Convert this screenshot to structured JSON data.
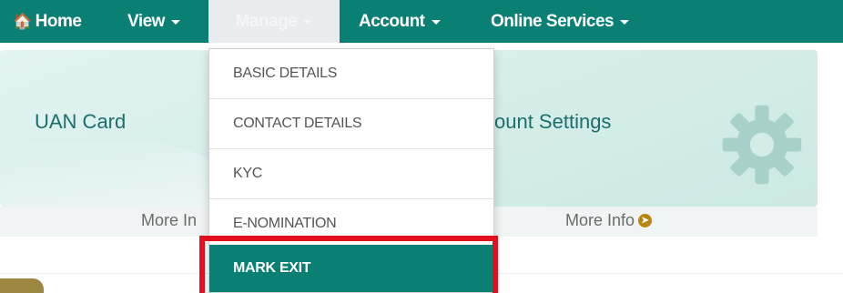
{
  "nav": {
    "home_label": "Home",
    "view_label": "View",
    "manage_label": "Manage",
    "account_label": "Account",
    "online_label": "Online Services"
  },
  "cards": {
    "uan_title": "UAN Card",
    "account_settings_title": "ount Settings",
    "more_info_left": "More In",
    "more_info_right": "More Info"
  },
  "dropdown": {
    "items": [
      {
        "label": "BASIC DETAILS"
      },
      {
        "label": "CONTACT DETAILS"
      },
      {
        "label": "KYC"
      },
      {
        "label": "E-NOMINATION"
      },
      {
        "label": "MARK EXIT",
        "highlighted": true
      }
    ]
  },
  "colors": {
    "brand": "#0a7f73",
    "highlight": "#e2101c",
    "card_bg": "#d6eeea"
  },
  "icons": [
    "home-icon",
    "gear-icon",
    "arrow-circle-right-icon",
    "caret-down-icon"
  ]
}
